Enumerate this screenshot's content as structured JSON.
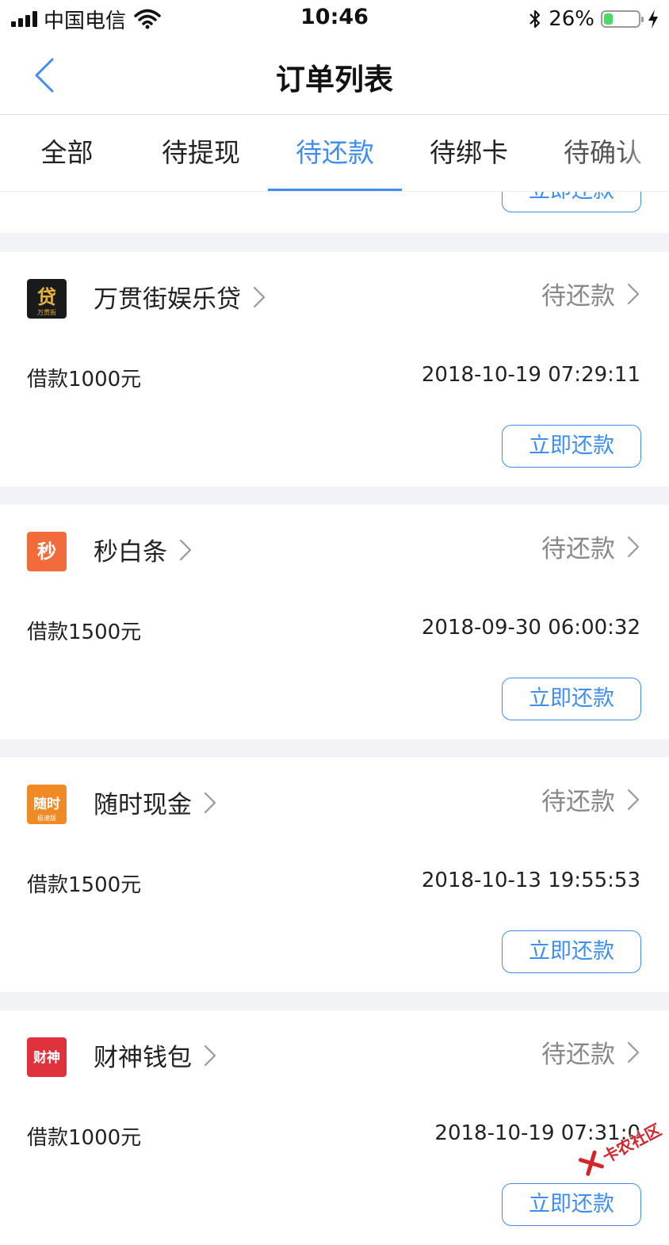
{
  "status_bar": {
    "carrier": "中国电信",
    "time": "10:46",
    "battery_percent": "26%",
    "battery_level": 0.26
  },
  "nav": {
    "title": "订单列表"
  },
  "tabs": [
    {
      "label": "全部",
      "active": false
    },
    {
      "label": "待提现",
      "active": false
    },
    {
      "label": "待还款",
      "active": true
    },
    {
      "label": "待绑卡",
      "active": false
    },
    {
      "label": "待确认",
      "active": false
    }
  ],
  "partial_card": {
    "button_label": "立即还款"
  },
  "orders": [
    {
      "app_name": "万贯街娱乐贷",
      "logo_text": "贷",
      "logo_sub": "万贯街",
      "logo_bg": "#1a1a1a",
      "logo_fg": "#e8b339",
      "status": "待还款",
      "loan": "借款1000元",
      "date": "2018-10-19 07:29:11",
      "button_label": "立即还款"
    },
    {
      "app_name": "秒白条",
      "logo_text": "秒",
      "logo_sub": "",
      "logo_bg": "#f26b3a",
      "logo_fg": "#ffffff",
      "status": "待还款",
      "loan": "借款1500元",
      "date": "2018-09-30 06:00:32",
      "button_label": "立即还款"
    },
    {
      "app_name": "随时现金",
      "logo_text": "随时",
      "logo_sub": "极速版",
      "logo_bg": "#f08a24",
      "logo_fg": "#ffffff",
      "status": "待还款",
      "loan": "借款1500元",
      "date": "2018-10-13 19:55:53",
      "button_label": "立即还款"
    },
    {
      "app_name": "财神钱包",
      "logo_text": "财神",
      "logo_sub": "",
      "logo_bg": "#e0323c",
      "logo_fg": "#ffffff",
      "status": "待还款",
      "loan": "借款1000元",
      "date": "2018-10-19 07:31:0",
      "button_label": "立即还款"
    }
  ],
  "watermark": {
    "text": "卡农社区"
  },
  "colors": {
    "accent": "#3d8ef0",
    "status_text": "#888888",
    "background": "#f2f3f7"
  }
}
